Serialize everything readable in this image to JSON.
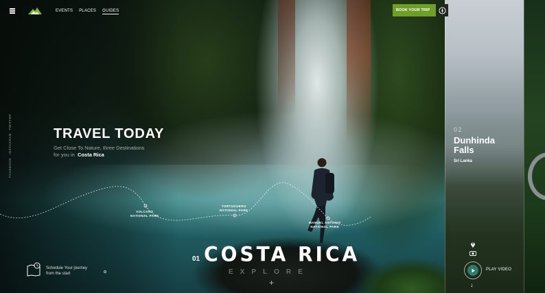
{
  "nav": {
    "items": [
      {
        "label": "EVENTS",
        "active": false
      },
      {
        "label": "PLACES",
        "active": false
      },
      {
        "label": "GUIDES",
        "active": true
      }
    ],
    "book_button": "BOOK YOUR TRIP",
    "book_icon": "compass-icon"
  },
  "social": [
    "TWITTER",
    "INSTAGRAM",
    "FACEBOOK"
  ],
  "hero": {
    "title": "TRAVEL TODAY",
    "subtitle_line1": "Get Close To Nature, three Destinations",
    "subtitle_line2_prefix": "for you in",
    "subtitle_highlight": "Costa Rica"
  },
  "route": {
    "stops": [
      {
        "line1": "VOLCANO",
        "line2": "NATIONAL PARK"
      },
      {
        "line1": "TORTUGUERO",
        "line2": "NATIONAL PARK"
      },
      {
        "line1": "MANUEL ANTONIO",
        "line2": "NATIONAL PARK"
      }
    ]
  },
  "destination": {
    "number": "01",
    "name": "COSTA RICA",
    "explore": "EXPLORE",
    "plus": "+"
  },
  "schedule": {
    "line1": "Schedule Your journey",
    "line2": "from the start"
  },
  "next_destination": {
    "number": "02",
    "title_line1": "Dunhinda",
    "title_line2": "Falls",
    "country": "Sri Lanka",
    "play_label": "PLAY VIDEO",
    "down_arrow": "↓"
  },
  "colors": {
    "accent_green": "#6f9e2a",
    "play_teal": "#2f7b6c"
  }
}
